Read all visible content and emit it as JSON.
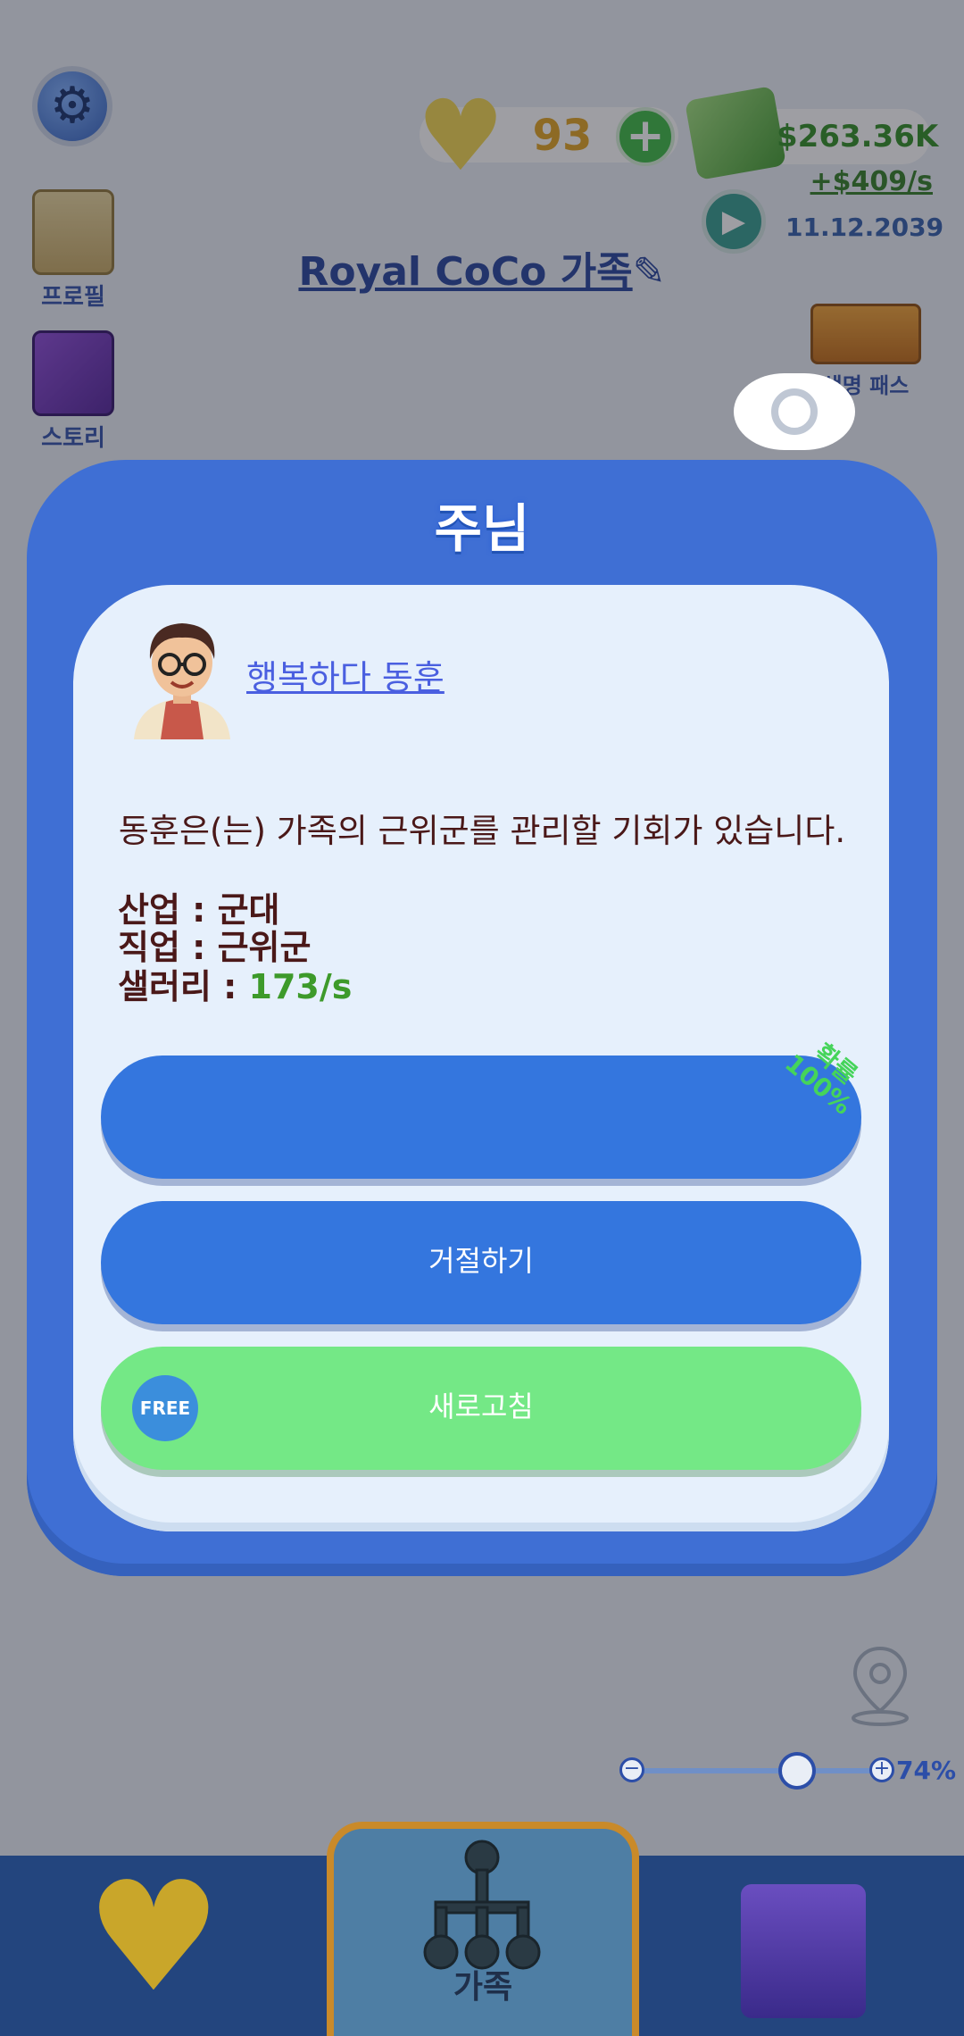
{
  "hud": {
    "hearts": "93",
    "cash": "$263.36K",
    "rate": "+$409/s",
    "date": "11.12.2039"
  },
  "family_title": "Royal CoCo 가족",
  "sidebar": {
    "profile_label": "프로필",
    "story_label": "스토리"
  },
  "pass_label": "생명 패스",
  "modal": {
    "title": "주님",
    "person_name": "행복하다 동훈",
    "description": "동훈은(는) 가족의 근위군를 관리할 기회가 있습니다.",
    "industry_label": "산업 : ",
    "industry_value": "군대",
    "job_label": "직업 : ",
    "job_value": "근위군",
    "salary_label": "샐러리 : ",
    "salary_value": "173/s",
    "accept_label": "",
    "probability_label": "확률",
    "probability_value": "100%",
    "reject_label": "거절하기",
    "refresh_label": "새로고침",
    "free_badge": "FREE"
  },
  "map": {
    "zoom": "74%",
    "zoom_level": 0.74
  },
  "nav": {
    "family_label": "가족"
  },
  "colors": {
    "modal_blue": "#3f6fd4",
    "button_blue": "#3476de",
    "button_green": "#74e886",
    "salary_green": "#3d9a2a"
  }
}
